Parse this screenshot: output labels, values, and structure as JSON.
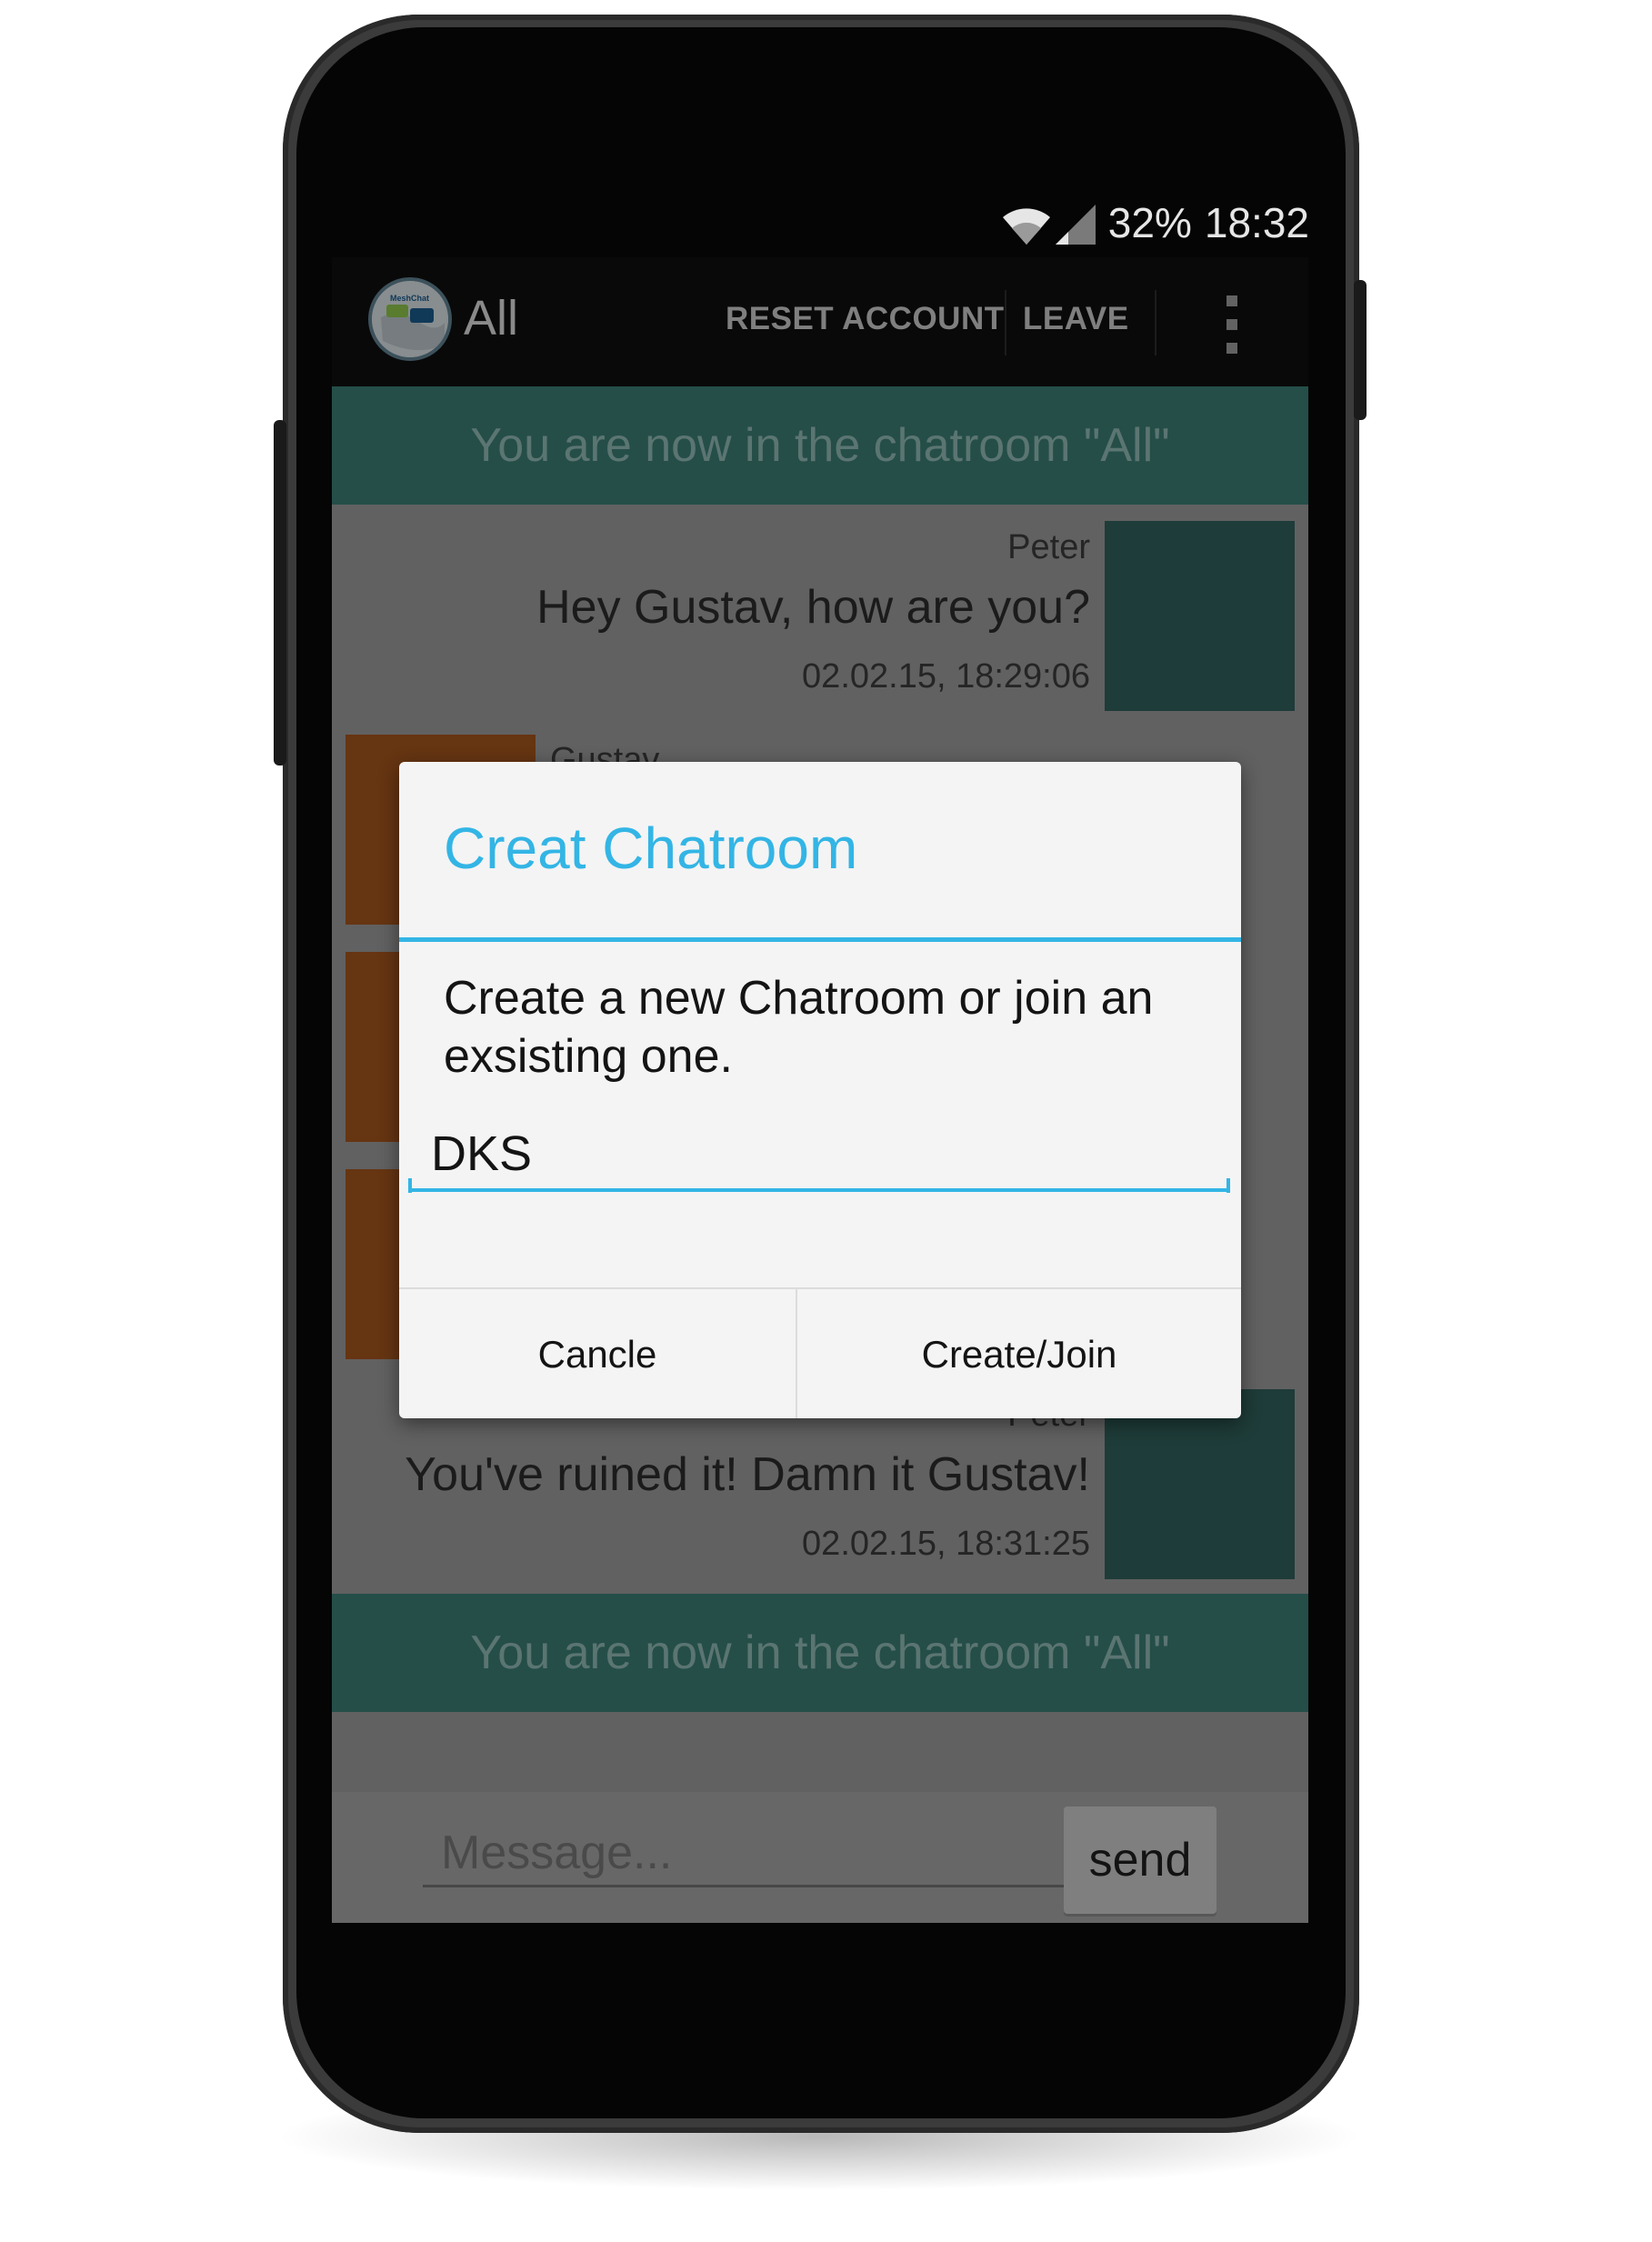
{
  "status_bar": {
    "battery": "32%",
    "time": "18:32",
    "icons": [
      "wifi-icon",
      "signal-icon"
    ]
  },
  "action_bar": {
    "title": "All",
    "logo_text": "MeshChat",
    "reset_account": "RESET ACCOUNT",
    "leave": "LEAVE",
    "overflow_icon": "overflow-menu-icon"
  },
  "chat": {
    "banner_top": "You are now in the chatroom \"All\"",
    "banner_bottom": "You are now in the chatroom \"All\"",
    "messages": [
      {
        "name": "Peter",
        "text": "Hey Gustav, how are you?",
        "time": "02.02.15, 18:29:06",
        "side": "right"
      },
      {
        "name": "Gustav",
        "text": "",
        "time": "",
        "side": "left"
      },
      {
        "name": "Peter",
        "text": "You've ruined it! Damn it Gustav!",
        "time": "02.02.15, 18:31:25",
        "side": "right"
      }
    ]
  },
  "composer": {
    "placeholder": "Message...",
    "send_label": "send"
  },
  "dialog": {
    "title": "Creat Chatroom",
    "message": "Create a new Chatroom or join an exsisting one.",
    "input_value": "DKS",
    "cancel_label": "Cancle",
    "confirm_label": "Create/Join"
  },
  "colors": {
    "accent": "#33b5e5",
    "banner": "#3b7a72",
    "peter_avatar": "#2f5f59",
    "gustav_avatar": "#a0531d"
  }
}
